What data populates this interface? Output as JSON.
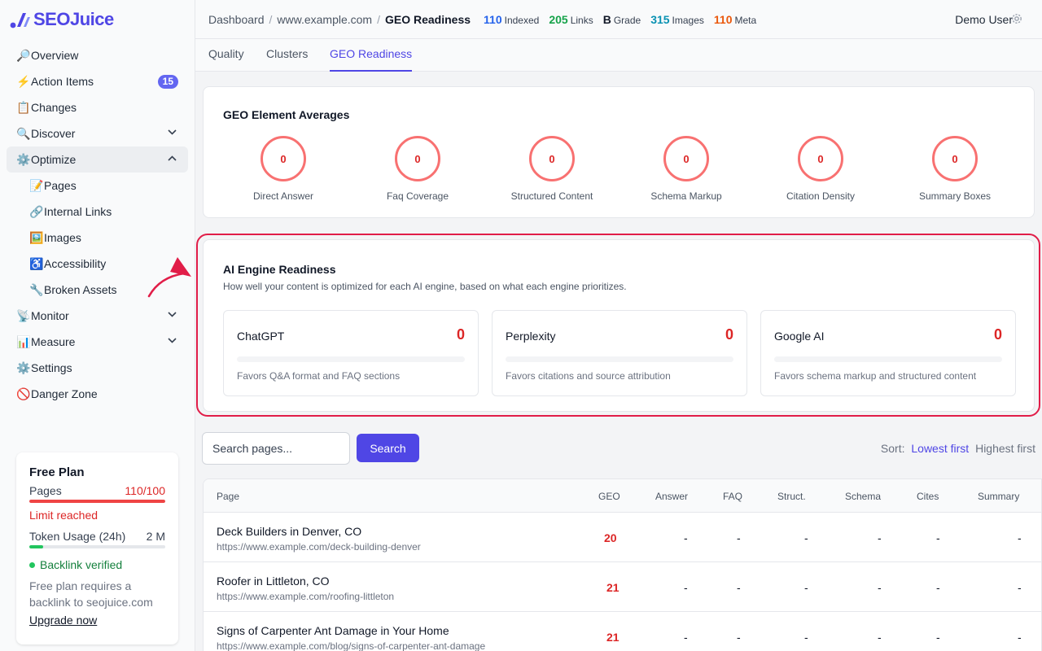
{
  "app": {
    "brand": "SEOJuice"
  },
  "sidebar": {
    "items": [
      {
        "icon": "🔎",
        "label": "Overview"
      },
      {
        "icon": "⚡",
        "label": "Action Items",
        "badge": "15"
      },
      {
        "icon": "📋",
        "label": "Changes"
      },
      {
        "icon": "🔍",
        "label": "Discover"
      },
      {
        "icon": "⚙️",
        "label": "Optimize"
      },
      {
        "icon": "📝",
        "label": "Pages"
      },
      {
        "icon": "🔗",
        "label": "Internal Links"
      },
      {
        "icon": "🖼️",
        "label": "Images"
      },
      {
        "icon": "♿",
        "label": "Accessibility"
      },
      {
        "icon": "🔧",
        "label": "Broken Assets"
      },
      {
        "icon": "📡",
        "label": "Monitor"
      },
      {
        "icon": "📊",
        "label": "Measure"
      },
      {
        "icon": "⚙️",
        "label": "Settings"
      },
      {
        "icon": "🚫",
        "label": "Danger Zone"
      }
    ]
  },
  "plan": {
    "title": "Free Plan",
    "pages_label": "Pages",
    "pages_value": "110/100",
    "pages_fill": 1.0,
    "limit_text": "Limit reached",
    "token_label": "Token Usage (24h)",
    "token_value": "2 M",
    "token_fill": 0.1,
    "verified_text": "Backlink verified",
    "note": "Free plan requires a backlink to seojuice.com",
    "upgrade": "Upgrade now"
  },
  "header": {
    "crumbs": [
      "Dashboard",
      "www.example.com",
      "GEO Readiness"
    ],
    "stats": [
      {
        "value": "110",
        "label": "Indexed",
        "color": "#2563eb"
      },
      {
        "value": "205",
        "label": "Links",
        "color": "#16a34a"
      },
      {
        "value": "B",
        "label": "Grade",
        "color": "#111827"
      },
      {
        "value": "315",
        "label": "Images",
        "color": "#0891b2"
      },
      {
        "value": "110",
        "label": "Meta",
        "color": "#ea580c"
      }
    ],
    "user": "Demo User"
  },
  "tabs": [
    "Quality",
    "Clusters",
    "GEO Readiness"
  ],
  "averages": {
    "title": "GEO Element Averages",
    "items": [
      {
        "label": "Direct Answer",
        "value": "0"
      },
      {
        "label": "Faq Coverage",
        "value": "0"
      },
      {
        "label": "Structured Content",
        "value": "0"
      },
      {
        "label": "Schema Markup",
        "value": "0"
      },
      {
        "label": "Citation Density",
        "value": "0"
      },
      {
        "label": "Summary Boxes",
        "value": "0"
      }
    ]
  },
  "engines": {
    "title": "AI Engine Readiness",
    "subtitle": "How well your content is optimized for each AI engine, based on what each engine prioritizes.",
    "items": [
      {
        "name": "ChatGPT",
        "score": "0",
        "desc": "Favors Q&A format and FAQ sections"
      },
      {
        "name": "Perplexity",
        "score": "0",
        "desc": "Favors citations and source attribution"
      },
      {
        "name": "Google AI",
        "score": "0",
        "desc": "Favors schema markup and structured content"
      }
    ]
  },
  "search": {
    "placeholder": "Search pages...",
    "button": "Search"
  },
  "sort": {
    "label": "Sort:",
    "options": [
      "Lowest first",
      "Highest first"
    ]
  },
  "table": {
    "columns": [
      "Page",
      "GEO",
      "Answer",
      "FAQ",
      "Struct.",
      "Schema",
      "Cites",
      "Summary"
    ],
    "rows": [
      {
        "title": "Deck Builders in Denver, CO",
        "url": "https://www.example.com/deck-building-denver",
        "geo": "20",
        "answer": "-",
        "faq": "-",
        "struct": "-",
        "schema": "-",
        "cites": "-",
        "summary": "-"
      },
      {
        "title": "Roofer in Littleton, CO",
        "url": "https://www.example.com/roofing-littleton",
        "geo": "21",
        "answer": "-",
        "faq": "-",
        "struct": "-",
        "schema": "-",
        "cites": "-",
        "summary": "-"
      },
      {
        "title": "Signs of Carpenter Ant Damage in Your Home",
        "url": "https://www.example.com/blog/signs-of-carpenter-ant-damage",
        "geo": "21",
        "answer": "-",
        "faq": "-",
        "struct": "-",
        "schema": "-",
        "cites": "-",
        "summary": "-"
      }
    ]
  }
}
